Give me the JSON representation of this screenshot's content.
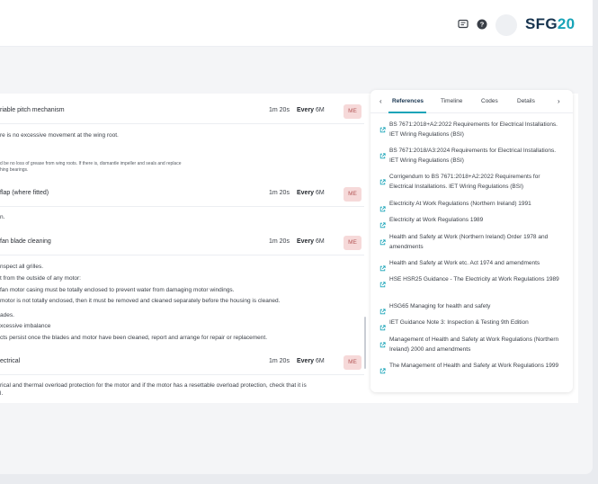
{
  "header": {
    "brand_main": "SFG",
    "brand_accent": "20",
    "icons": [
      "chat-icon",
      "help-icon"
    ]
  },
  "tasks": [
    {
      "name": "riable pitch mechanism",
      "duration": "1m 20s",
      "freq_prefix": "Every",
      "freq_value": "6M",
      "badge": "ME",
      "steps": [
        "re is no excessive movement at the wing root.",
        "d be no loss of grease from wing roots. If there is, dismantle impeller and seals and replace",
        "hing bearings."
      ]
    },
    {
      "name": "flap (where fitted)",
      "duration": "1m 20s",
      "freq_prefix": "Every",
      "freq_value": "6M",
      "badge": "ME",
      "steps": [
        "n."
      ]
    },
    {
      "name": "fan blade cleaning",
      "duration": "1m 20s",
      "freq_prefix": "Every",
      "freq_value": "6M",
      "badge": "ME",
      "steps": [
        "nspect all grilles.",
        "t from the outside of any motor:",
        "fan motor casing must be totally enclosed to prevent water from damaging motor windings.",
        "motor is not totally enclosed, then it must be removed and cleaned separately before the housing is cleaned.",
        "ades.",
        "xcessive imbalance",
        "cts persist once the blades and motor have been cleaned, report and arrange for repair or replacement."
      ]
    },
    {
      "name": "ectrical",
      "duration": "1m 20s",
      "freq_prefix": "Every",
      "freq_value": "6M",
      "badge": "ME",
      "steps": [
        "rical and thermal overload protection for the motor and if the motor has a resettable overload protection, check that it is",
        "l."
      ]
    }
  ],
  "panel": {
    "tabs": [
      "References",
      "Timeline",
      "Codes",
      "Details"
    ],
    "active_tab": "References",
    "prev_arrow": "‹",
    "next_arrow": "›",
    "references": [
      "BS 7671:2018+A2:2022 Requirements for Electrical Installations. IET Wiring Regulations (BSI)",
      "BS 7671:2018/A3:2024 Requirements for Electrical Installations. IET Wiring Regulations (BSI)",
      "Corrigendum to BS 7671:2018+A2:2022 Requirements for Electrical Installations. IET Wiring Regulations (BSI)",
      "Electricity At Work Regulations (Northern Ireland) 1991",
      "Electricity at Work Regulations 1989",
      "Health and Safety at Work (Northern Ireland) Order 1978 and amendments",
      "Health and Safety at Work etc. Act 1974 and amendments",
      "HSE HSR25 Guidance - The Electricity at Work Regulations 1989",
      "HSG65 Managing for health and safety",
      "IET Guidance Note 3: Inspection & Testing 9th Edition",
      "Management of Health and Safety at Work Regulations (Northern Ireland) 2000 and amendments",
      "The Management of Health and Safety at Work Regulations 1999"
    ]
  },
  "colors": {
    "brand_dark": "#17344f",
    "brand_accent": "#18a4b8",
    "badge_bg": "#f6d9d9",
    "badge_text": "#b55a5a"
  }
}
